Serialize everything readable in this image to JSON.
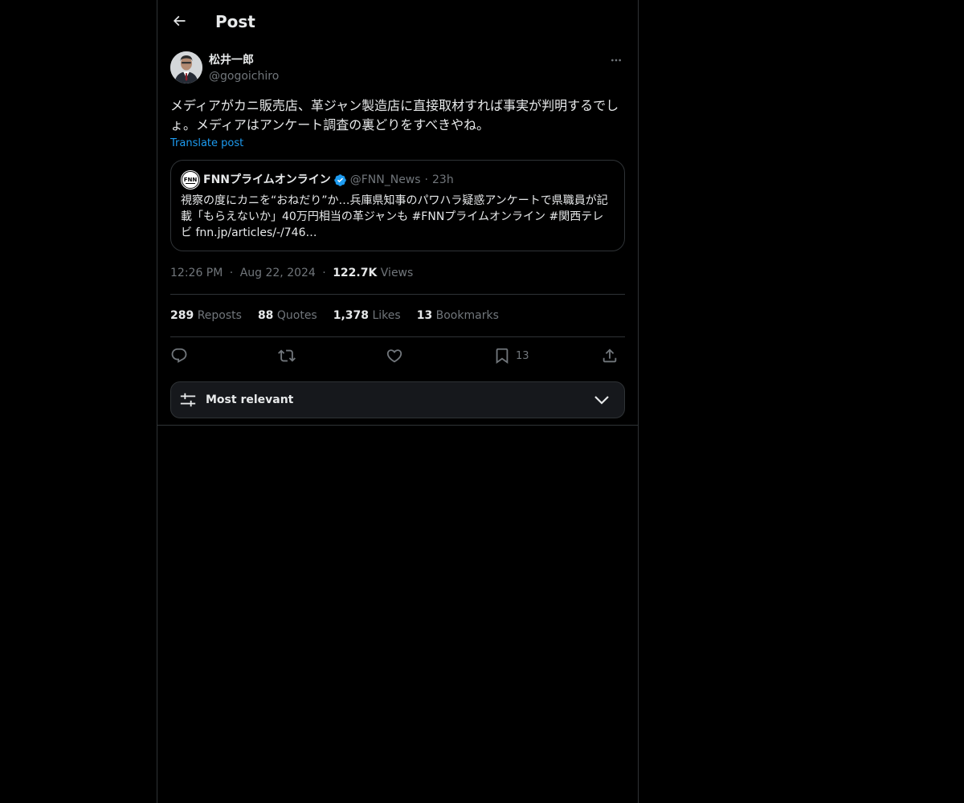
{
  "header": {
    "title": "Post"
  },
  "post": {
    "author_name": "松井一郎",
    "author_handle": "@gogoichiro",
    "text": "メディアがカニ販売店、革ジャン製造店に直接取材すれば事実が判明するでしょ。メディアはアンケート調査の裏どりをすべきやね。",
    "translate_label": "Translate post",
    "time": "12:26 PM",
    "date": "Aug 22, 2024",
    "views_count": "122.7K",
    "views_label": "Views",
    "separator": "·"
  },
  "quoted": {
    "name": "FNNプライムオンライン",
    "handle": "@FNN_News",
    "separator": "·",
    "age": "23h",
    "text": "視察の度にカニを“おねだり”か…兵庫県知事のパワハラ疑惑アンケートで県職員が記載「もらえないか」40万円相当の革ジャンも #FNNプライムオンライン #関西テレビ fnn.jp/articles/-/746…",
    "verified_color": "#1d9bf0"
  },
  "stats": {
    "reposts_count": "289",
    "reposts_label": "Reposts",
    "quotes_count": "88",
    "quotes_label": "Quotes",
    "likes_count": "1,378",
    "likes_label": "Likes",
    "bookmarks_count": "13",
    "bookmarks_label": "Bookmarks"
  },
  "actions": {
    "reply_icon": "reply-icon",
    "repost_icon": "repost-icon",
    "like_icon": "heart-icon",
    "bookmark_icon": "bookmark-icon",
    "bookmark_count": "13",
    "share_icon": "share-icon"
  },
  "sort": {
    "label": "Most relevant"
  },
  "colors": {
    "background": "#000000",
    "text": "#e7e9ea",
    "secondary": "#71767b",
    "accent": "#1d9bf0",
    "border": "#2f3336"
  }
}
